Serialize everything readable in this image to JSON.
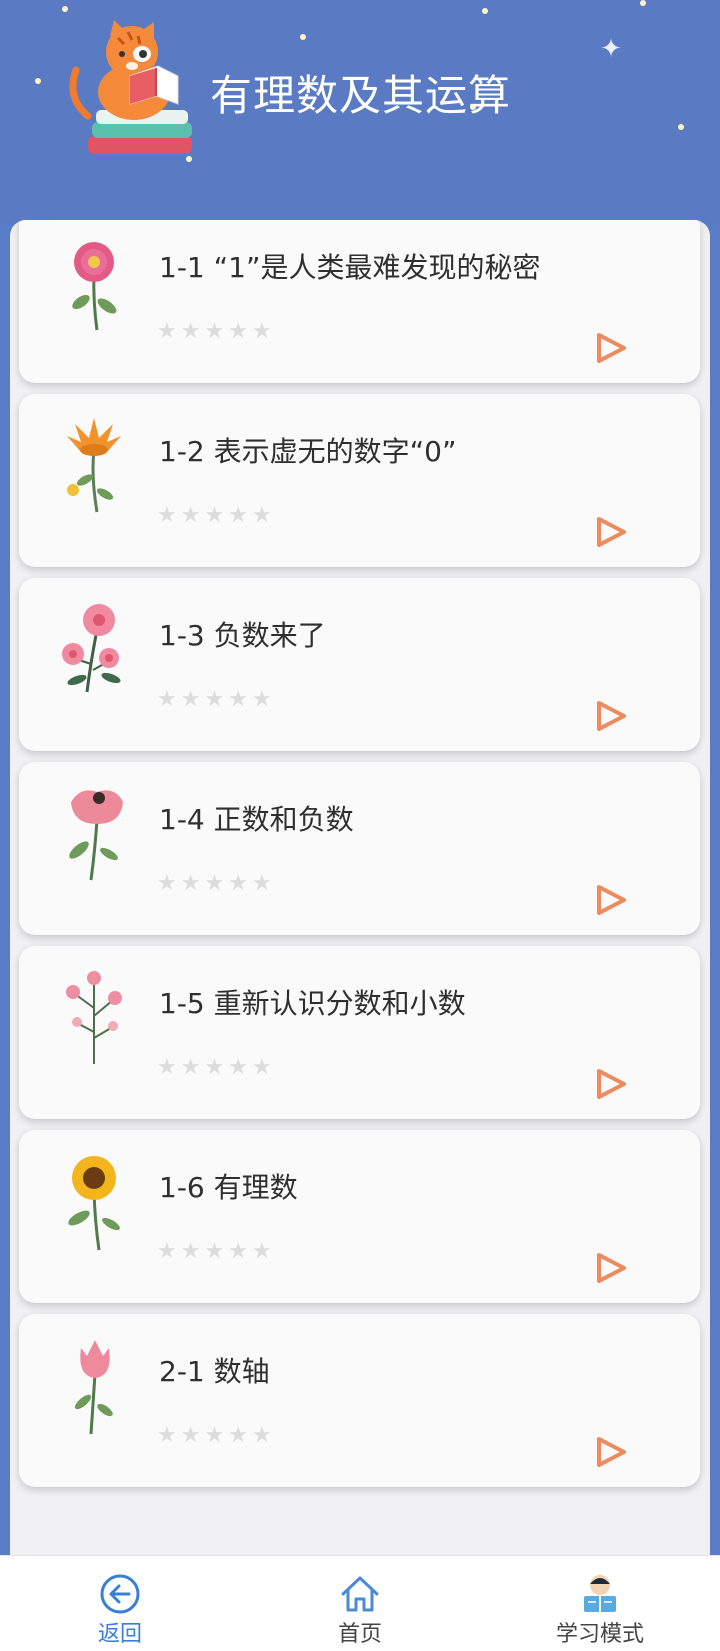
{
  "header": {
    "title": "有理数及其运算"
  },
  "lessons": [
    {
      "title": "1-1 “1”是人类最难发现的秘密",
      "rating": 0
    },
    {
      "title": "1-2 表示虚无的数字“0”",
      "rating": 0
    },
    {
      "title": "1-3 负数来了",
      "rating": 0
    },
    {
      "title": "1-4 正数和负数",
      "rating": 0
    },
    {
      "title": "1-5 重新认识分数和小数",
      "rating": 0
    },
    {
      "title": "1-6 有理数",
      "rating": 0
    },
    {
      "title": "2-1 数轴",
      "rating": 0
    }
  ],
  "tabs": [
    {
      "label": "返回",
      "icon": "back-arrow-icon",
      "active": true
    },
    {
      "label": "首页",
      "icon": "home-icon",
      "active": false
    },
    {
      "label": "学习模式",
      "icon": "study-mode-icon",
      "active": false
    }
  ],
  "colors": {
    "header_bg": "#5a7ac4",
    "accent_orange": "#f08a5d",
    "tab_active": "#3a7fd6",
    "star_empty": "#dcdcdc"
  }
}
